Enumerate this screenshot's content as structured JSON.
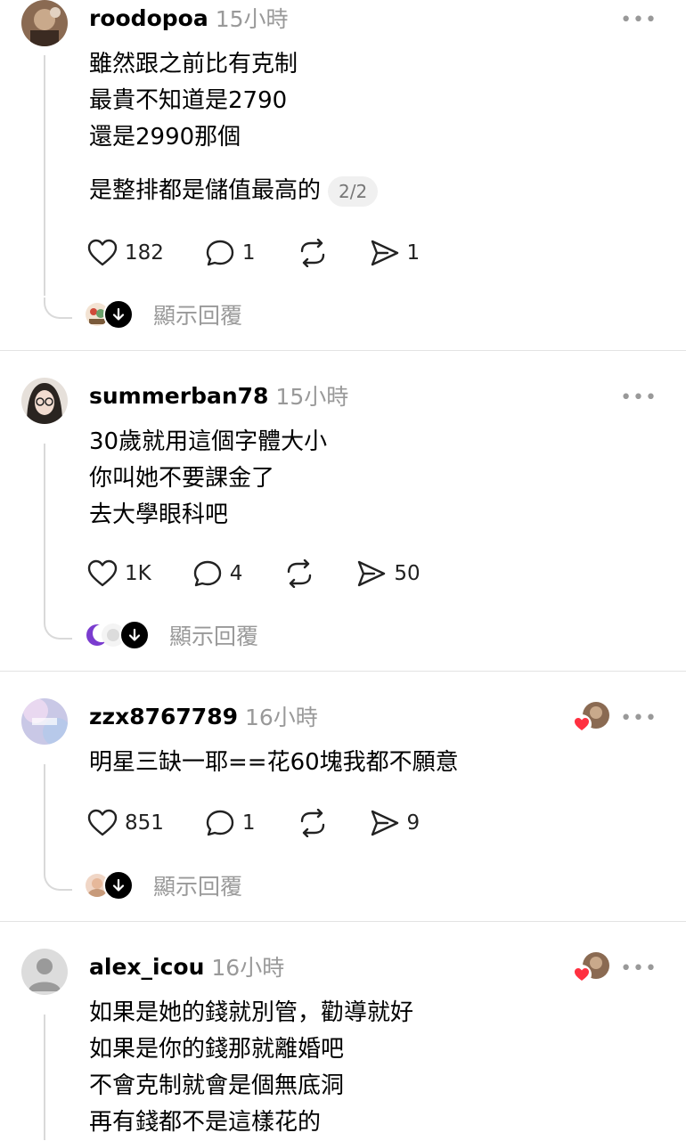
{
  "posts": [
    {
      "username": "roodopoa",
      "time": "15小時",
      "lines": [
        "雖然跟之前比有克制",
        "最貴不知道是2790",
        "還是2990那個"
      ],
      "extra_line": "是整排都是儲值最高的",
      "pager": "2/2",
      "likes": "182",
      "comments": "1",
      "shares": "1",
      "show_replies": "顯示回覆",
      "more": "•••"
    },
    {
      "username": "summerban78",
      "time": "15小時",
      "lines": [
        "30歲就用這個字體大小",
        "你叫她不要課金了",
        "去大學眼科吧"
      ],
      "likes": "1K",
      "comments": "4",
      "shares": "50",
      "show_replies": "顯示回覆",
      "more": "•••"
    },
    {
      "username": "zzx8767789",
      "time": "16小時",
      "lines": [
        "明星三缺一耶==花60塊我都不願意"
      ],
      "likes": "851",
      "comments": "1",
      "shares": "9",
      "show_replies": "顯示回覆",
      "more": "•••"
    },
    {
      "username": "alex_icou",
      "time": "16小時",
      "lines": [
        "如果是她的錢就別管，勸導就好",
        "如果是你的錢那就離婚吧",
        "不會克制就會是個無底洞",
        "再有錢都不是這樣花的"
      ],
      "more": "•••"
    }
  ],
  "colors": {
    "muted": "#999999",
    "divider": "#e3e3e3",
    "heart": "#ff3040"
  },
  "icons": [
    "heart-icon",
    "comment-icon",
    "repost-icon",
    "send-icon",
    "more-icon",
    "arrow-down-icon"
  ]
}
